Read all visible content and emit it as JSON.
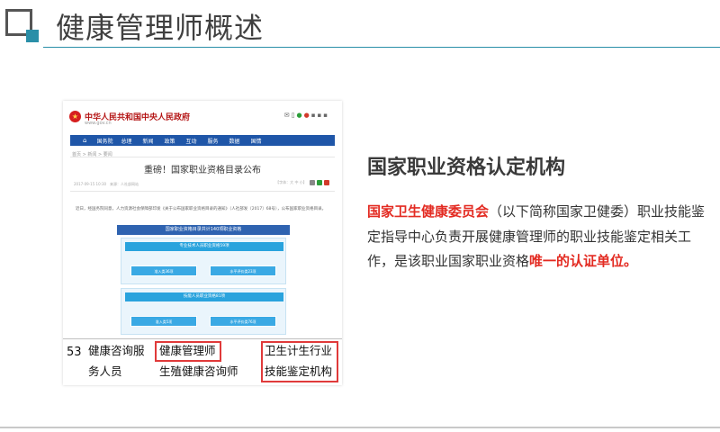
{
  "slide": {
    "title": "健康管理师概述",
    "section_heading": "国家职业资格认定机构",
    "description": {
      "org_name": "国家卫生健康委员会",
      "part1": "（以下简称国家卫健委）职业技能鉴定指导中心负责开展健康管理师的职业技能鉴定相关工作，是该职业国家职业资格",
      "highlight_end": "唯一的认证单位。"
    }
  },
  "screenshot": {
    "site_name": "中华人民共和国中央人民政府",
    "site_url": "www.gov.cn",
    "nav_items": [
      "国务院",
      "总理",
      "新闻",
      "政策",
      "互动",
      "服务",
      "数据",
      "国情"
    ],
    "breadcrumb": "首页 > 新闻 > 要闻",
    "article_title": "重磅！国家职业资格目录公布",
    "meta_date": "2017-09-15 10:30　来源：人社部网站",
    "meta_font": "【字体：大 中 小】",
    "body_text": "近日，经国务院同意，人力资源社会保障部印发《关于公布国家职业资格目录的通知》（人社部发〔2017〕68号），公布国家职业资格目录。",
    "diagram": {
      "header": "国家职业资格目录共计140项职业资格",
      "section1": "专业技术人员职业资格59项",
      "section1_cells": [
        "准入类36项",
        "水平评价类23项"
      ],
      "section2": "技能人员职业资格81项",
      "section2_cells": [
        "准入类5项",
        "水平评价类76项"
      ]
    },
    "table_row": {
      "number": "53",
      "category_line1": "健康咨询服",
      "category_line2": "务人员",
      "occupation1": "健康管理师",
      "occupation2": "生殖健康咨询师",
      "authority_line1": "卫生计生行业",
      "authority_line2": "技能鉴定机构"
    }
  },
  "colors": {
    "accent": "#2a8fa8",
    "highlight_red": "#e32b22",
    "gov_blue": "#1f56a8"
  }
}
